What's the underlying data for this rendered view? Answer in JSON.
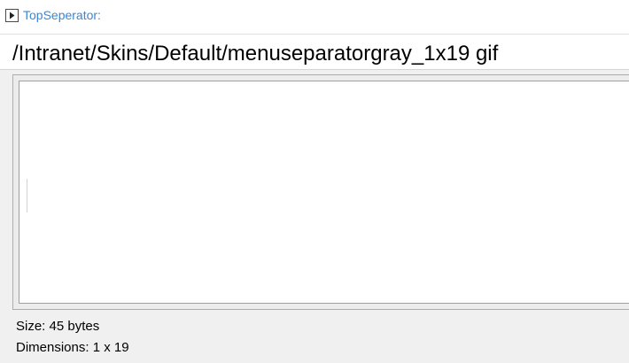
{
  "section": {
    "toggle_icon": "expand-arrow-icon",
    "label": "TopSeperator:",
    "label_color": "#3a86d6"
  },
  "file": {
    "path": "/Intranet/Skins/Default/menuseparatorgray_1x19 gif"
  },
  "preview": {
    "image": "menu-separator-gray-image"
  },
  "info": {
    "size": "Size: 45 bytes",
    "dimensions": "Dimensions: 1 x 19"
  }
}
